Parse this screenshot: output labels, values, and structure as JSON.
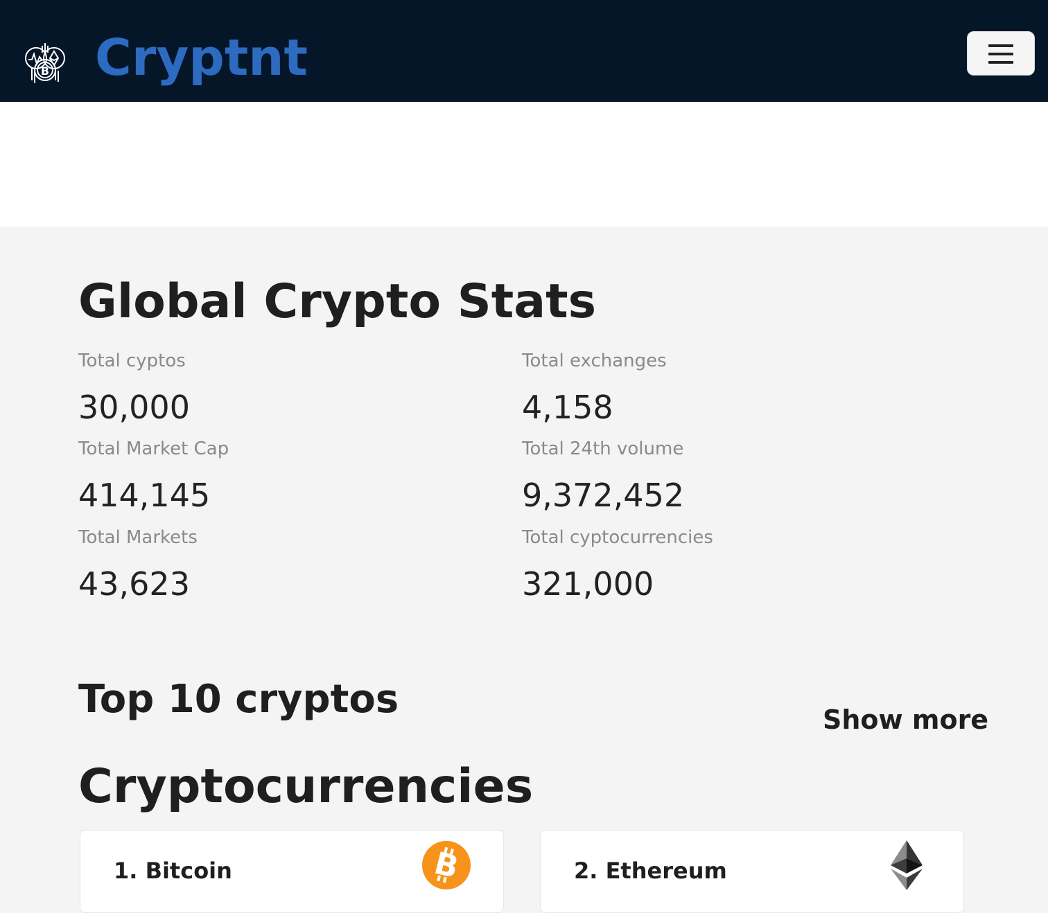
{
  "header": {
    "brand": "Cryptnt",
    "logo_icon": "crypto-logo-icon",
    "menu_icon": "hamburger-menu-icon"
  },
  "global_stats": {
    "title": "Global Crypto Stats",
    "items": [
      {
        "label": "Total cyptos",
        "value": "30,000"
      },
      {
        "label": "Total exchanges",
        "value": "4,158"
      },
      {
        "label": "Total Market Cap",
        "value": "414,145"
      },
      {
        "label": "Total 24th volume",
        "value": "9,372,452"
      },
      {
        "label": "Total Markets",
        "value": "43,623"
      },
      {
        "label": "Total cyptocurrencies",
        "value": "321,000"
      }
    ]
  },
  "top10": {
    "title": "Top 10 cryptos",
    "show_more": "Show more"
  },
  "cryptocurrencies": {
    "title": "Cryptocurrencies",
    "cards": [
      {
        "title": "1. Bitcoin",
        "icon": "bitcoin-icon",
        "icon_color": "#f7931a"
      },
      {
        "title": "2. Ethereum",
        "icon": "ethereum-icon",
        "icon_color": "#343434"
      }
    ]
  },
  "colors": {
    "navbar_bg": "#061629",
    "brand": "#2d6bc1",
    "page_bg": "#f4f4f4"
  }
}
